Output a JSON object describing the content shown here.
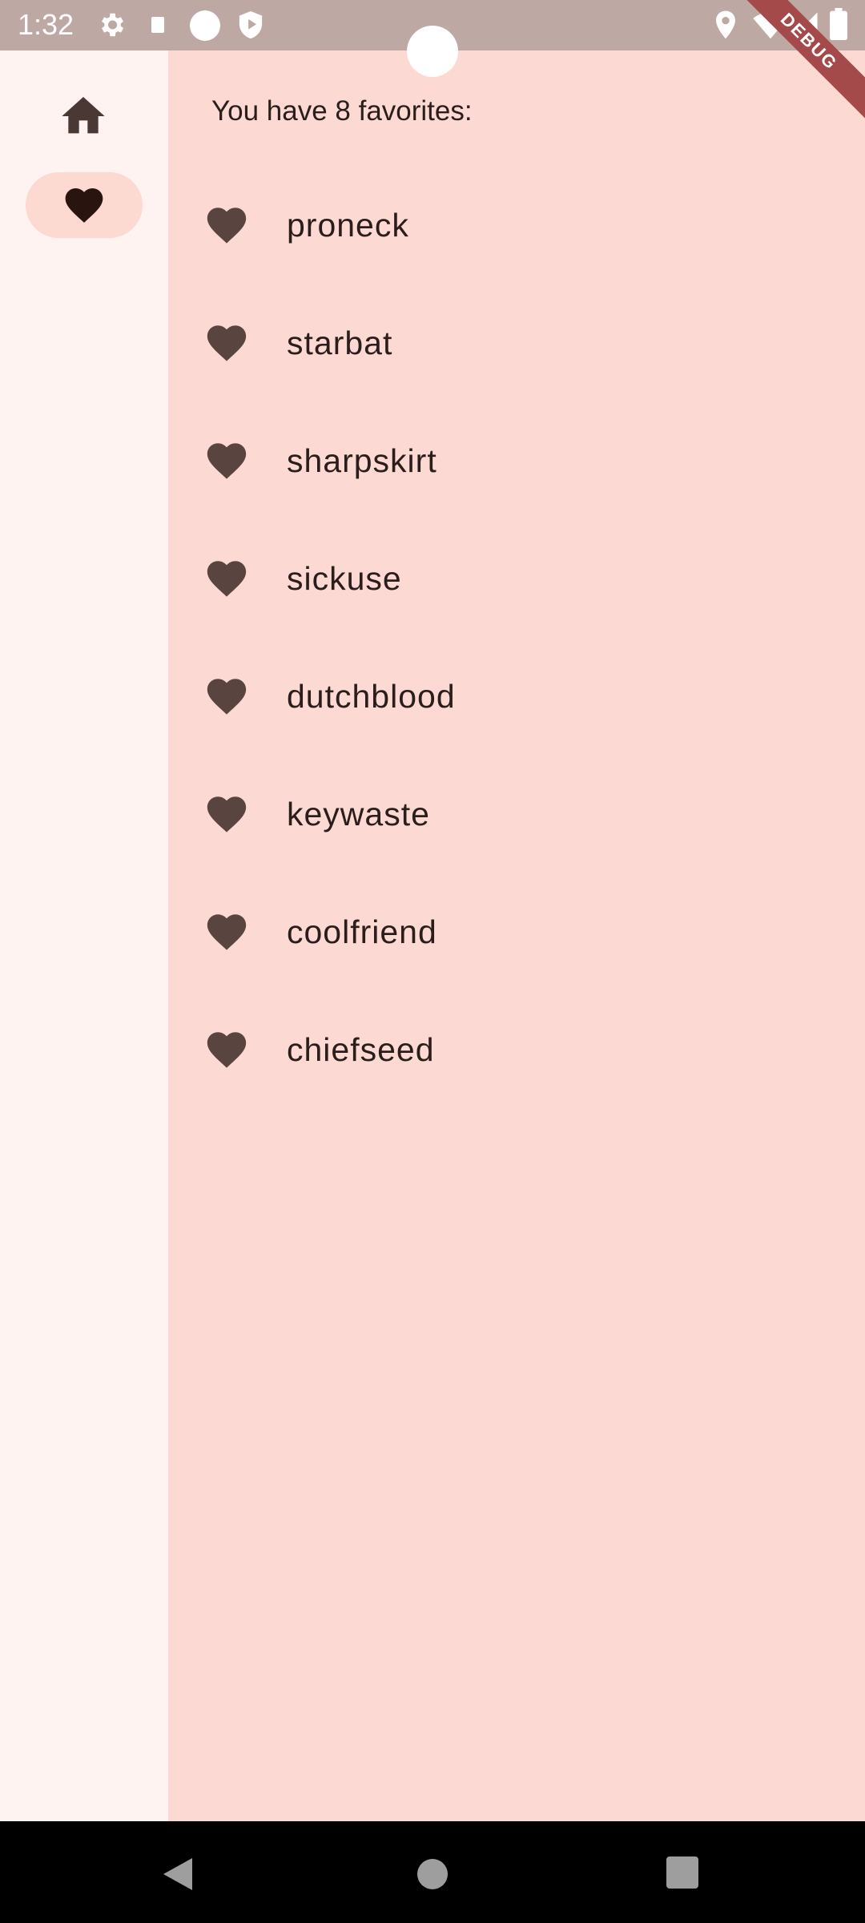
{
  "status_bar": {
    "time": "1:32",
    "left_icons": [
      "settings-icon",
      "sim-icon",
      "circle-icon",
      "shield-play-icon"
    ],
    "right_icons": [
      "location-icon",
      "wifi-icon",
      "signal-icon",
      "battery-icon"
    ],
    "debug_label": "DEBUG"
  },
  "rail": {
    "items": [
      {
        "icon": "home-icon",
        "selected": false
      },
      {
        "icon": "heart-icon",
        "selected": true
      }
    ]
  },
  "favorites": {
    "header": "You have 8 favorites:",
    "items": [
      {
        "label": "proneck"
      },
      {
        "label": "starbat"
      },
      {
        "label": "sharpskirt"
      },
      {
        "label": "sickuse"
      },
      {
        "label": "dutchblood"
      },
      {
        "label": "keywaste"
      },
      {
        "label": "coolfriend"
      },
      {
        "label": "chiefseed"
      }
    ]
  },
  "nav_bar": {
    "buttons": [
      "back-icon",
      "home-circle-icon",
      "recents-icon"
    ]
  },
  "colors": {
    "rail_bg": "#fef3f1",
    "content_bg": "#fcdad3",
    "indicator": "#fcd9d1",
    "heart": "#5a4440",
    "status_bar": "#bea8a3"
  }
}
